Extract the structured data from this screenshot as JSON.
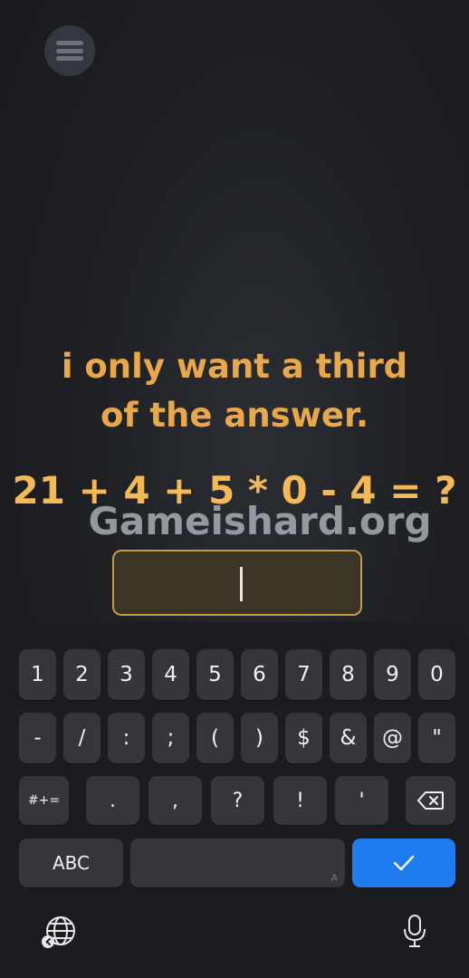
{
  "game": {
    "menu_icon": "hamburger-menu-icon",
    "question_line1": "i only want a third",
    "question_line2": "of the answer.",
    "equation": "21 + 4 + 5 * 0 - 4 = ?",
    "watermark": "Gameishard.org",
    "answer_value": ""
  },
  "keyboard": {
    "row1": [
      "1",
      "2",
      "3",
      "4",
      "5",
      "6",
      "7",
      "8",
      "9",
      "0"
    ],
    "row2": [
      "-",
      "/",
      ":",
      ";",
      "(",
      ")",
      "$",
      "&",
      "@",
      "\""
    ],
    "row3": [
      "#+=",
      ".",
      ",",
      "?",
      "!",
      "'"
    ],
    "abc_label": "ABC",
    "space_hint": "A",
    "enter_icon": "checkmark-icon",
    "backspace_icon": "backspace-icon",
    "globe_icon": "globe-icon",
    "mic_icon": "microphone-icon",
    "enter_color": "#1e7cf0"
  }
}
